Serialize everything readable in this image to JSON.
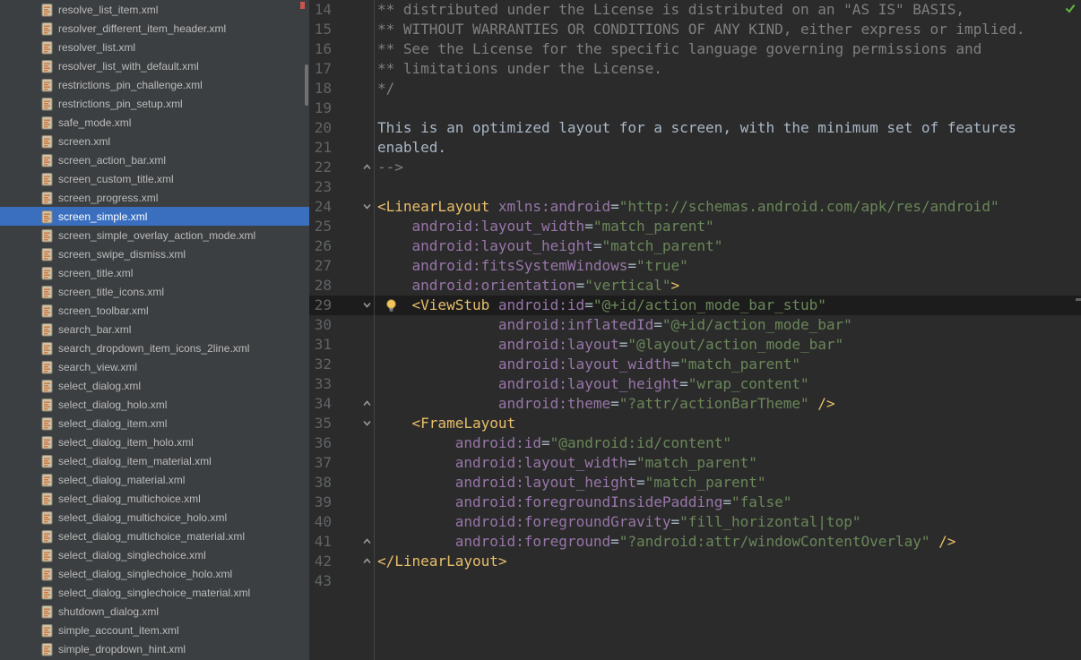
{
  "colors": {
    "sidebar_bg": "#3c3f41",
    "editor_bg": "#2b2b2b",
    "selection_bg": "#3a6fc0",
    "caret_line_bg": "#1c1c1c",
    "line_number": "#606366",
    "gutter_line": "#404346",
    "comment": "#808080",
    "plain_text": "#a9b7c6",
    "xml_tag": "#e8bf6a",
    "xml_attribute": "#9876aa",
    "xml_value": "#6a8759",
    "file_label": "#bbbbbb",
    "selected_label": "#ffffff",
    "inspection_ok": "#62b543",
    "lightbulb": "#f2c55c",
    "lightbulb_stroke": "#a8893f",
    "fold_marker": "#9b9b9b",
    "stripe_mark": "#c75450",
    "file_icon_page": "#cdc3ad",
    "file_icon_border": "#8f876f",
    "file_icon_lines": "#d1763a"
  },
  "sidebar": {
    "selected_file": "screen_simple.xml",
    "files": [
      "resolve_list_item.xml",
      "resolver_different_item_header.xml",
      "resolver_list.xml",
      "resolver_list_with_default.xml",
      "restrictions_pin_challenge.xml",
      "restrictions_pin_setup.xml",
      "safe_mode.xml",
      "screen.xml",
      "screen_action_bar.xml",
      "screen_custom_title.xml",
      "screen_progress.xml",
      "screen_simple.xml",
      "screen_simple_overlay_action_mode.xml",
      "screen_swipe_dismiss.xml",
      "screen_title.xml",
      "screen_title_icons.xml",
      "screen_toolbar.xml",
      "search_bar.xml",
      "search_dropdown_item_icons_2line.xml",
      "search_view.xml",
      "select_dialog.xml",
      "select_dialog_holo.xml",
      "select_dialog_item.xml",
      "select_dialog_item_holo.xml",
      "select_dialog_item_material.xml",
      "select_dialog_material.xml",
      "select_dialog_multichoice.xml",
      "select_dialog_multichoice_holo.xml",
      "select_dialog_multichoice_material.xml",
      "select_dialog_singlechoice.xml",
      "select_dialog_singlechoice_holo.xml",
      "select_dialog_singlechoice_material.xml",
      "shutdown_dialog.xml",
      "simple_account_item.xml",
      "simple_dropdown_hint.xml"
    ]
  },
  "editor": {
    "caret_line_number": 29,
    "lines": [
      {
        "n": 14,
        "segs": [
          [
            "cm",
            "** distributed under the License is distributed on an \"AS IS\" BASIS,"
          ]
        ]
      },
      {
        "n": 15,
        "segs": [
          [
            "cm",
            "** WITHOUT WARRANTIES OR CONDITIONS OF ANY KIND, either express or implied."
          ]
        ]
      },
      {
        "n": 16,
        "segs": [
          [
            "cm",
            "** See the License for the specific language governing permissions and"
          ]
        ]
      },
      {
        "n": 17,
        "segs": [
          [
            "cm",
            "** limitations under the License."
          ]
        ]
      },
      {
        "n": 18,
        "segs": [
          [
            "cm",
            "*/"
          ]
        ]
      },
      {
        "n": 19,
        "segs": []
      },
      {
        "n": 20,
        "segs": [
          [
            "tx",
            "This is an optimized layout for a screen, with the minimum set of features"
          ]
        ]
      },
      {
        "n": 21,
        "segs": [
          [
            "tx",
            "enabled."
          ]
        ]
      },
      {
        "n": 22,
        "fold": "end",
        "segs": [
          [
            "cm",
            "-->"
          ]
        ]
      },
      {
        "n": 23,
        "segs": []
      },
      {
        "n": 24,
        "fold": "start",
        "segs": [
          [
            "tag",
            "<LinearLayout "
          ],
          [
            "attr",
            "xmlns:android"
          ],
          [
            "eq",
            "="
          ],
          [
            "val",
            "\"http://schemas.android.com/apk/res/android\""
          ]
        ]
      },
      {
        "n": 25,
        "segs": [
          [
            "ws",
            "    "
          ],
          [
            "attr",
            "android:layout_width"
          ],
          [
            "eq",
            "="
          ],
          [
            "val",
            "\"match_parent\""
          ]
        ]
      },
      {
        "n": 26,
        "segs": [
          [
            "ws",
            "    "
          ],
          [
            "attr",
            "android:layout_height"
          ],
          [
            "eq",
            "="
          ],
          [
            "val",
            "\"match_parent\""
          ]
        ]
      },
      {
        "n": 27,
        "segs": [
          [
            "ws",
            "    "
          ],
          [
            "attr",
            "android:fitsSystemWindows"
          ],
          [
            "eq",
            "="
          ],
          [
            "val",
            "\"true\""
          ]
        ]
      },
      {
        "n": 28,
        "segs": [
          [
            "ws",
            "    "
          ],
          [
            "attr",
            "android:orientation"
          ],
          [
            "eq",
            "="
          ],
          [
            "val",
            "\"vertical\""
          ],
          [
            "tag",
            ">"
          ]
        ]
      },
      {
        "n": 29,
        "caret": true,
        "bulb": true,
        "fold": "start",
        "segs": [
          [
            "ws",
            "    "
          ],
          [
            "tag",
            "<ViewStub "
          ],
          [
            "attr",
            "android:id"
          ],
          [
            "eq",
            "="
          ],
          [
            "val",
            "\"@+id/action_mode_bar_stub\""
          ]
        ]
      },
      {
        "n": 30,
        "segs": [
          [
            "ws",
            "              "
          ],
          [
            "attr",
            "android:inflatedId"
          ],
          [
            "eq",
            "="
          ],
          [
            "val",
            "\"@+id/action_mode_bar\""
          ]
        ]
      },
      {
        "n": 31,
        "segs": [
          [
            "ws",
            "              "
          ],
          [
            "attr",
            "android:layout"
          ],
          [
            "eq",
            "="
          ],
          [
            "val",
            "\"@layout/action_mode_bar\""
          ]
        ]
      },
      {
        "n": 32,
        "segs": [
          [
            "ws",
            "              "
          ],
          [
            "attr",
            "android:layout_width"
          ],
          [
            "eq",
            "="
          ],
          [
            "val",
            "\"match_parent\""
          ]
        ]
      },
      {
        "n": 33,
        "segs": [
          [
            "ws",
            "              "
          ],
          [
            "attr",
            "android:layout_height"
          ],
          [
            "eq",
            "="
          ],
          [
            "val",
            "\"wrap_content\""
          ]
        ]
      },
      {
        "n": 34,
        "fold": "end",
        "segs": [
          [
            "ws",
            "              "
          ],
          [
            "attr",
            "android:theme"
          ],
          [
            "eq",
            "="
          ],
          [
            "val",
            "\"?attr/actionBarTheme\""
          ],
          [
            "tag",
            " />"
          ]
        ]
      },
      {
        "n": 35,
        "fold": "start",
        "segs": [
          [
            "ws",
            "    "
          ],
          [
            "tag",
            "<FrameLayout"
          ]
        ]
      },
      {
        "n": 36,
        "segs": [
          [
            "ws",
            "         "
          ],
          [
            "attr",
            "android:id"
          ],
          [
            "eq",
            "="
          ],
          [
            "val",
            "\"@android:id/content\""
          ]
        ]
      },
      {
        "n": 37,
        "segs": [
          [
            "ws",
            "         "
          ],
          [
            "attr",
            "android:layout_width"
          ],
          [
            "eq",
            "="
          ],
          [
            "val",
            "\"match_parent\""
          ]
        ]
      },
      {
        "n": 38,
        "segs": [
          [
            "ws",
            "         "
          ],
          [
            "attr",
            "android:layout_height"
          ],
          [
            "eq",
            "="
          ],
          [
            "val",
            "\"match_parent\""
          ]
        ]
      },
      {
        "n": 39,
        "segs": [
          [
            "ws",
            "         "
          ],
          [
            "attr",
            "android:foregroundInsidePadding"
          ],
          [
            "eq",
            "="
          ],
          [
            "val",
            "\"false\""
          ]
        ]
      },
      {
        "n": 40,
        "segs": [
          [
            "ws",
            "         "
          ],
          [
            "attr",
            "android:foregroundGravity"
          ],
          [
            "eq",
            "="
          ],
          [
            "val",
            "\"fill_horizontal|top\""
          ]
        ]
      },
      {
        "n": 41,
        "fold": "end",
        "segs": [
          [
            "ws",
            "         "
          ],
          [
            "attr",
            "android:foreground"
          ],
          [
            "eq",
            "="
          ],
          [
            "val",
            "\"?android:attr/windowContentOverlay\""
          ],
          [
            "tag",
            " />"
          ]
        ]
      },
      {
        "n": 42,
        "fold": "end",
        "segs": [
          [
            "tag",
            "</LinearLayout>"
          ]
        ]
      },
      {
        "n": 43,
        "segs": []
      }
    ]
  }
}
